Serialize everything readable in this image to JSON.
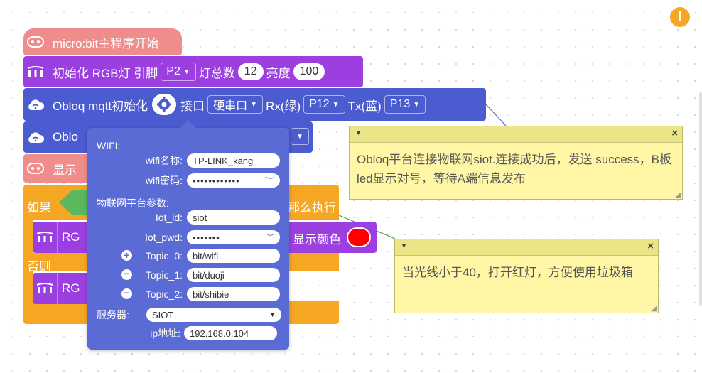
{
  "colors": {
    "pink": "#ef8d8d",
    "purple": "#9c3fe0",
    "blue": "#4b5bd0",
    "orange": "#f5a623",
    "popup": "#5b6bd6",
    "note_bg": "#fff7a6"
  },
  "warning_icon": "warning-icon",
  "start_block": {
    "label": "micro:bit主程序开始"
  },
  "rgb_init": {
    "label": "初始化 RGB灯 引脚",
    "pin": "P2",
    "count_label": "灯总数",
    "count": "12",
    "brightness_label": "亮度",
    "brightness": "100"
  },
  "obloq_init": {
    "label": "Obloq mqtt初始化",
    "port_label": "接口",
    "port": "硬串口",
    "rx_label": "Rx(绿)",
    "rx": "P12",
    "tx_label": "Tx(蓝)",
    "tx": "P13"
  },
  "obloq_send": {
    "label": "Oblo"
  },
  "show_block": {
    "label": "显示"
  },
  "if_block": {
    "if_label": "如果",
    "then_label": "那么执行",
    "else_label": "否则"
  },
  "rgb_inner1": {
    "label": "RG",
    "color_label": "显示颜色"
  },
  "rgb_inner2": {
    "label": "RG"
  },
  "popup": {
    "wifi_section": "WIFI:",
    "wifi_name_label": "wifi名称:",
    "wifi_name": "TP-LINK_kang",
    "wifi_pwd_label": "wifi密码:",
    "wifi_pwd": "••••••••••••",
    "iot_section": "物联网平台参数:",
    "iot_id_label": "Iot_id:",
    "iot_id": "siot",
    "iot_pwd_label": "Iot_pwd:",
    "iot_pwd": "•••••••",
    "topic0_label": "Topic_0:",
    "topic0": "bit/wifi",
    "topic1_label": "Topic_1:",
    "topic1": "bit/duoji",
    "topic2_label": "Topic_2:",
    "topic2": "bit/shibie",
    "server_label": "服务器:",
    "server": "SIOT",
    "ip_label": "ip地址:",
    "ip": "192.168.0.104"
  },
  "comment1": {
    "text": "Obloq平台连接物联网siot.连接成功后，发送 success，B板led显示对号，等待A端信息发布"
  },
  "comment2": {
    "text": "当光线小于40，打开红灯，方便使用垃圾箱"
  }
}
